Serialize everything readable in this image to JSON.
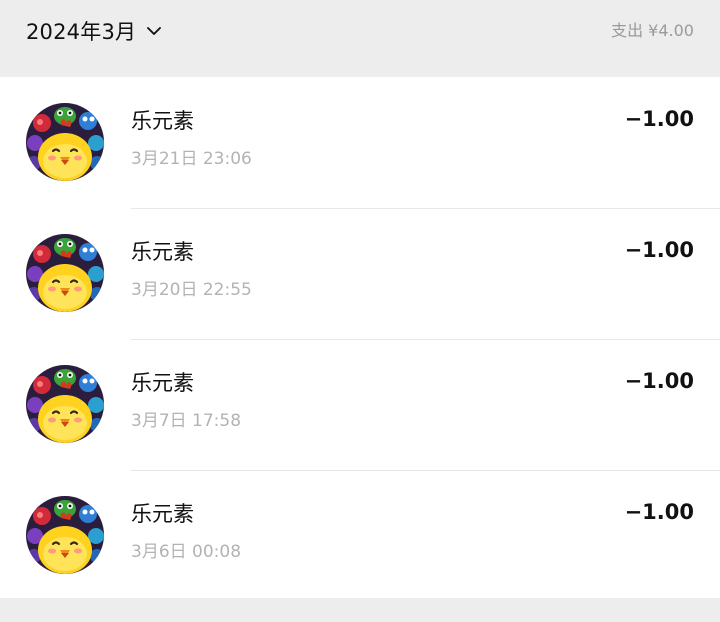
{
  "header": {
    "month_label": "2024年3月",
    "summary": "支出 ¥4.00"
  },
  "transactions": [
    {
      "merchant": "乐元素",
      "time": "3月21日 23:06",
      "amount": "−1.00"
    },
    {
      "merchant": "乐元素",
      "time": "3月20日 22:55",
      "amount": "−1.00"
    },
    {
      "merchant": "乐元素",
      "time": "3月7日 17:58",
      "amount": "−1.00"
    },
    {
      "merchant": "乐元素",
      "time": "3月6日 00:08",
      "amount": "−1.00"
    }
  ],
  "icons": {
    "month_dropdown": "chevron-down-icon",
    "merchant_avatar": "game-app-chick-avatar"
  },
  "colors": {
    "background": "#ededed",
    "list_background": "#ffffff",
    "primary_text": "#111111",
    "secondary_text": "#b3b3b3",
    "summary_text": "#9a9a9a"
  }
}
